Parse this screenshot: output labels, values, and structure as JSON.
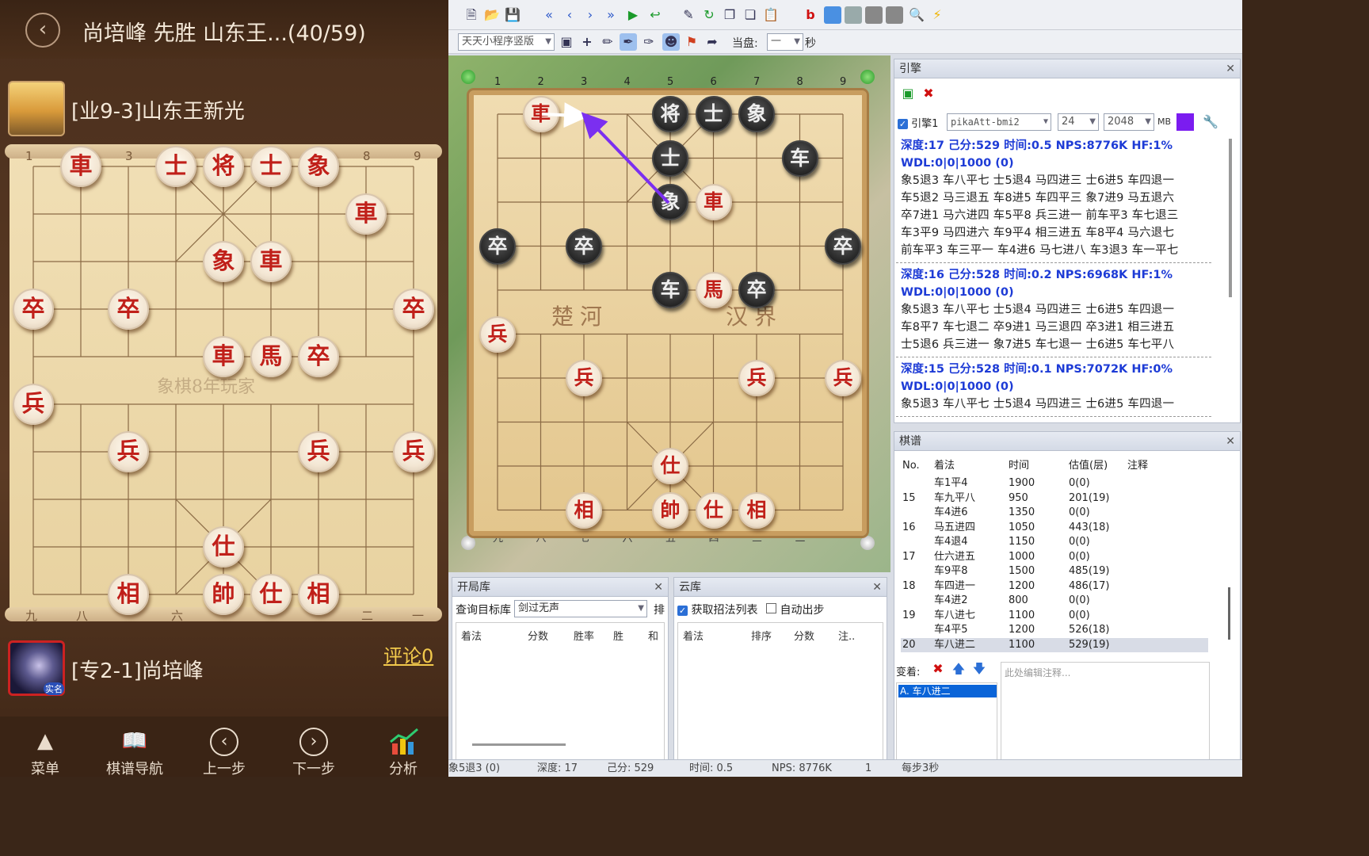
{
  "left": {
    "back_icon": "chevron-left-icon",
    "title": "尚培峰 先胜 山东王...(40/59)",
    "top_player": "[业9-3]山东王新光",
    "bottom_player": "[专2-1]尚培峰",
    "avatar_badge": "实名",
    "comment": "评论0",
    "file_numbers_top": [
      "1",
      "3",
      "8",
      "9"
    ],
    "file_numbers_bottom": [
      "九",
      "八",
      "六",
      "二",
      "一"
    ],
    "watermark": "象棋8年玩家",
    "nav": [
      {
        "label": "菜单",
        "icon": "menu-up-icon"
      },
      {
        "label": "棋谱导航",
        "icon": "book-icon"
      },
      {
        "label": "上一步",
        "icon": "prev-icon"
      },
      {
        "label": "下一步",
        "icon": "next-icon"
      },
      {
        "label": "分析",
        "icon": "chart-icon"
      }
    ],
    "pieces": [
      {
        "t": "車",
        "c": "r"
      },
      {
        "t": "士",
        "c": "r"
      },
      {
        "t": "将",
        "c": "r"
      },
      {
        "t": "士",
        "c": "r"
      },
      {
        "t": "象",
        "c": "r"
      },
      {
        "t": "車",
        "c": "r"
      },
      {
        "t": "象",
        "c": "r"
      },
      {
        "t": "車",
        "c": "r"
      },
      {
        "t": "卒",
        "c": "r"
      },
      {
        "t": "卒",
        "c": "r"
      },
      {
        "t": "卒",
        "c": "r"
      },
      {
        "t": "車",
        "c": "r"
      },
      {
        "t": "馬",
        "c": "r"
      },
      {
        "t": "卒",
        "c": "r"
      },
      {
        "t": "兵",
        "c": "r"
      },
      {
        "t": "兵",
        "c": "r"
      },
      {
        "t": "兵",
        "c": "r"
      },
      {
        "t": "兵",
        "c": "r"
      },
      {
        "t": "仕",
        "c": "r"
      },
      {
        "t": "相",
        "c": "r"
      },
      {
        "t": "帥",
        "c": "r"
      },
      {
        "t": "仕",
        "c": "r"
      },
      {
        "t": "相",
        "c": "r"
      }
    ]
  },
  "toolbar": {
    "style_combo": "天天小程序竖版",
    "time_label": "当盘:",
    "time_value": "一",
    "time_unit": "秒"
  },
  "rboard": {
    "file_numbers_top": [
      "1",
      "2",
      "3",
      "4",
      "5",
      "6",
      "7",
      "8",
      "9"
    ],
    "file_numbers_bottom": [
      "九",
      "八",
      "七",
      "六",
      "五",
      "四",
      "三",
      "二",
      "一"
    ],
    "river_left": "楚河",
    "river_right": "汉界",
    "pieces": [
      {
        "t": "車",
        "c": "r"
      },
      {
        "t": "将",
        "c": "b"
      },
      {
        "t": "士",
        "c": "b"
      },
      {
        "t": "象",
        "c": "b"
      },
      {
        "t": "士",
        "c": "b"
      },
      {
        "t": "车",
        "c": "b"
      },
      {
        "t": "象",
        "c": "b"
      },
      {
        "t": "車",
        "c": "r"
      },
      {
        "t": "卒",
        "c": "b"
      },
      {
        "t": "卒",
        "c": "b"
      },
      {
        "t": "卒",
        "c": "b"
      },
      {
        "t": "车",
        "c": "b"
      },
      {
        "t": "馬",
        "c": "r"
      },
      {
        "t": "卒",
        "c": "b"
      },
      {
        "t": "兵",
        "c": "r"
      },
      {
        "t": "兵",
        "c": "r"
      },
      {
        "t": "兵",
        "c": "r"
      },
      {
        "t": "兵",
        "c": "r"
      },
      {
        "t": "仕",
        "c": "r"
      },
      {
        "t": "相",
        "c": "r"
      },
      {
        "t": "帥",
        "c": "r"
      },
      {
        "t": "仕",
        "c": "r"
      },
      {
        "t": "相",
        "c": "r"
      }
    ]
  },
  "engine": {
    "title": "引擎",
    "engine_label": "引擎1",
    "engine_name": "pikaAtt-bmi2",
    "threads": "24",
    "hash": "2048",
    "hash_unit": "MB",
    "blocks": [
      {
        "info": "深度:17  己分:529  时间:0.5  NPS:8776K HF:1%",
        "wdl": "WDL:0|0|1000 (0)",
        "lines": [
          "象5退3 车八平七 士5退4 马四进三 士6进5 车四退一",
          "车5退2 马三退五 车8进5 车四平三 象7进9 马五退六",
          "卒7进1 马六进四 车5平8 兵三进一 前车平3 车七退三",
          "车3平9 马四进六 车9平4 相三进五 车8平4 马六退七",
          "前车平3 车三平一 车4进6 马七进八 车3退3 车一平七"
        ]
      },
      {
        "info": "深度:16  己分:528  时间:0.2  NPS:6968K HF:1%",
        "wdl": "WDL:0|0|1000 (0)",
        "lines": [
          "象5退3 车八平七 士5退4 马四进三 士6进5 车四退一",
          "车8平7 车七退二 卒9进1 马三退四 卒3进1 相三进五",
          "士5退6 兵三进一 象7进5 车七退一 士6进5 车七平八"
        ]
      },
      {
        "info": "深度:15  己分:528  时间:0.1  NPS:7072K HF:0%",
        "wdl": "WDL:0|0|1000 (0)",
        "lines": [
          "象5退3 车八平七 士5退4 马四进三 士6进5 车四退一"
        ]
      }
    ]
  },
  "qipu": {
    "title": "棋谱",
    "headers": [
      "No.",
      "着法",
      "时间",
      "估值(层)",
      "注释"
    ],
    "rows": [
      {
        "no": "",
        "move": "车1平4",
        "time": "1900",
        "eval": "0(0)"
      },
      {
        "no": "15",
        "move": "车九平八",
        "time": "950",
        "eval": "201(19)"
      },
      {
        "no": "",
        "move": "车4进6",
        "time": "1350",
        "eval": "0(0)"
      },
      {
        "no": "16",
        "move": "马五进四",
        "time": "1050",
        "eval": "443(18)"
      },
      {
        "no": "",
        "move": "车4退4",
        "time": "1150",
        "eval": "0(0)"
      },
      {
        "no": "17",
        "move": "仕六进五",
        "time": "1000",
        "eval": "0(0)"
      },
      {
        "no": "",
        "move": "车9平8",
        "time": "1500",
        "eval": "485(19)"
      },
      {
        "no": "18",
        "move": "车四进一",
        "time": "1200",
        "eval": "486(17)"
      },
      {
        "no": "",
        "move": "车4进2",
        "time": "800",
        "eval": "0(0)"
      },
      {
        "no": "19",
        "move": "车八进七",
        "time": "1100",
        "eval": "0(0)"
      },
      {
        "no": "",
        "move": "车4平5",
        "time": "1200",
        "eval": "526(18)"
      },
      {
        "no": "20",
        "move": "车八进二",
        "time": "1100",
        "eval": "529(19)"
      }
    ],
    "variation_label": "变着:",
    "variation_item": "A. 车八进二",
    "note_placeholder": "此处编辑注释..."
  },
  "kaiju": {
    "title": "开局库",
    "query_label": "查询目标库",
    "query_value": "剑过无声",
    "sort_label": "排",
    "headers": [
      "着法",
      "分数",
      "胜率",
      "胜",
      "和"
    ]
  },
  "yunku": {
    "title": "云库",
    "fetch_label": "获取招法列表",
    "auto_label": "自动出步",
    "headers": [
      "着法",
      "排序",
      "分数",
      "注.."
    ]
  },
  "status": {
    "move": "象5退3 (0)",
    "depth": "深度: 17",
    "score": "己分: 529",
    "time": "时间: 0.5",
    "nps": "NPS: 8776K",
    "num": "1",
    "per_step": "每步3秒"
  },
  "colors": {
    "accent": "#1d3bd6",
    "arrow": "#7b2ff0",
    "selected": "#0a64d8"
  }
}
